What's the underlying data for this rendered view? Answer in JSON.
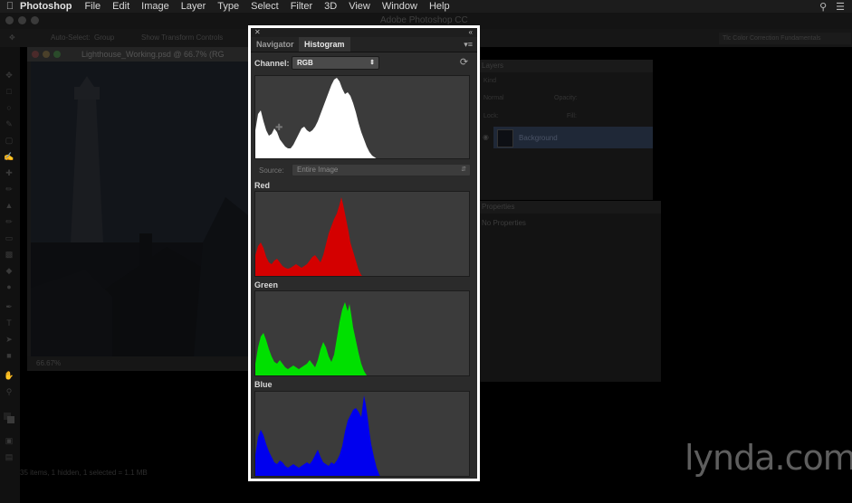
{
  "menubar": {
    "app_name": "Photoshop",
    "items": [
      "File",
      "Edit",
      "Image",
      "Layer",
      "Type",
      "Select",
      "Filter",
      "3D",
      "View",
      "Window",
      "Help"
    ]
  },
  "window": {
    "title": "Adobe Photoshop CC"
  },
  "options_bar": {
    "auto_select": "Auto-Select:",
    "group": "Group",
    "transform": "Show Transform Controls"
  },
  "workspace": "Tlc Color Correction Fundamentals",
  "document": {
    "tab_name": "Lighthouse_Working.psd @ 66.7% (RG",
    "zoom": "66.67%",
    "status": "35 items, 1 hidden, 1 selected = 1.1 MB"
  },
  "layers_panel": {
    "tab": "Layers",
    "kind": "Kind",
    "blend_mode": "Normal",
    "opacity_label": "Opacity:",
    "lock_label": "Lock:",
    "fill_label": "Fill:",
    "layer_name": "Background"
  },
  "properties_panel": {
    "tab": "Properties",
    "text": "No Properties"
  },
  "histogram_panel": {
    "tabs": [
      "Navigator",
      "Histogram"
    ],
    "active_tab": "Histogram",
    "channel_label": "Channel:",
    "channel_value": "RGB",
    "source_label": "Source:",
    "source_value": "Entire Image",
    "channels": [
      {
        "name": "Red",
        "color": "#d40000"
      },
      {
        "name": "Green",
        "color": "#00e000"
      },
      {
        "name": "Blue",
        "color": "#0000ee"
      }
    ],
    "composite_color": "#ffffff"
  },
  "logo": "lynda.com",
  "icons": [
    "apple-icon",
    "search-icon",
    "list-icon",
    "close-icon",
    "collapse-icon",
    "panel-menu-icon",
    "refresh-icon",
    "chevron-down-icon",
    "eye-icon"
  ]
}
